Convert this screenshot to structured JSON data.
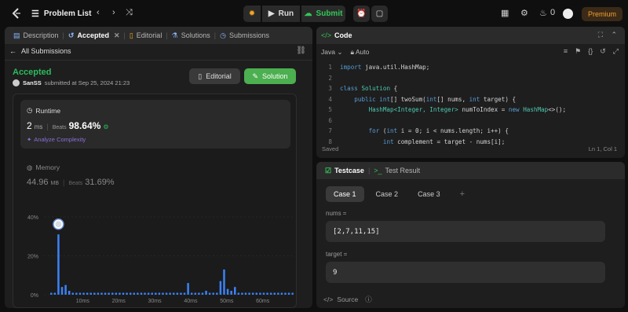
{
  "topbar": {
    "problem_list": "Problem List",
    "run": "Run",
    "submit": "Submit",
    "streak_count": "0",
    "premium": "Premium"
  },
  "left": {
    "tabs": [
      {
        "label": "Description",
        "icon": "description-icon"
      },
      {
        "label": "Accepted",
        "icon": "history-icon"
      },
      {
        "label": "Editorial",
        "icon": "book-icon"
      },
      {
        "label": "Solutions",
        "icon": "flask-icon"
      },
      {
        "label": "Submissions",
        "icon": "clock-icon"
      }
    ],
    "back_label": "All Submissions",
    "status": "Accepted",
    "user": "SanSS",
    "submitted_text": "submitted at Sep 25, 2024 21:23",
    "editorial_btn": "Editorial",
    "solution_btn": "Solution",
    "runtime": {
      "title": "Runtime",
      "value": "2",
      "unit": "ms",
      "beats_label": "Beats",
      "beats_value": "98.64%",
      "analyze": "Analyze Complexity"
    },
    "memory": {
      "title": "Memory",
      "value": "44.96",
      "unit": "MB",
      "beats_label": "Beats",
      "beats_value": "31.69%"
    }
  },
  "chart_data": {
    "type": "bar",
    "ylim": [
      0,
      40
    ],
    "y_ticks": [
      "40%",
      "20%",
      "0%"
    ],
    "x_ticks": [
      "10ms",
      "20ms",
      "30ms",
      "40ms",
      "50ms",
      "60ms"
    ],
    "x": [
      1,
      2,
      3,
      4,
      5,
      6,
      7,
      8,
      9,
      10,
      11,
      12,
      13,
      14,
      15,
      16,
      17,
      18,
      19,
      20,
      21,
      22,
      23,
      24,
      25,
      26,
      27,
      28,
      29,
      30,
      31,
      32,
      33,
      34,
      35,
      36,
      37,
      38,
      39,
      40,
      41,
      42,
      43,
      44,
      45,
      46,
      47,
      48,
      49,
      50,
      51,
      52,
      53,
      54,
      55,
      56,
      57,
      58,
      59,
      60,
      61,
      62,
      63,
      64,
      65,
      66,
      67,
      68
    ],
    "values": [
      1,
      1,
      31,
      4,
      5,
      2,
      1,
      1,
      1,
      1,
      1,
      1,
      1,
      1,
      1,
      1,
      1,
      1,
      1,
      1,
      1,
      1,
      1,
      1,
      1,
      1,
      1,
      1,
      1,
      1,
      1,
      1,
      1,
      1,
      1,
      1,
      1,
      1,
      6,
      1,
      1,
      1,
      1,
      2,
      1,
      1,
      1,
      7,
      13,
      3,
      2,
      4,
      1,
      1,
      1,
      1,
      1,
      1,
      1,
      1,
      1,
      1,
      1,
      1,
      1,
      1,
      1,
      1
    ],
    "highlight_index": 2
  },
  "code": {
    "title": "Code",
    "language": "Java",
    "auto": "Auto",
    "status": "Saved",
    "position": "Ln 1, Col 1",
    "lines": [
      "import java.util.HashMap;",
      "",
      "class Solution {",
      "    public int[] twoSum(int[] nums, int target) {",
      "        HashMap<Integer, Integer> numToIndex = new HashMap<>();",
      "",
      "        for (int i = 0; i < nums.length; i++) {",
      "            int complement = target - nums[i];"
    ]
  },
  "test": {
    "tab_testcase": "Testcase",
    "tab_result": "Test Result",
    "cases": [
      "Case 1",
      "Case 2",
      "Case 3"
    ],
    "add": "+",
    "nums_label": "nums =",
    "nums_value": "[2,7,11,15]",
    "target_label": "target =",
    "target_value": "9",
    "source": "Source"
  },
  "colors": {
    "accent_green": "#34c759",
    "accepted_green": "#2cbb5d",
    "chart_blue": "#3b82f6",
    "premium_orange": "#f0a030"
  }
}
